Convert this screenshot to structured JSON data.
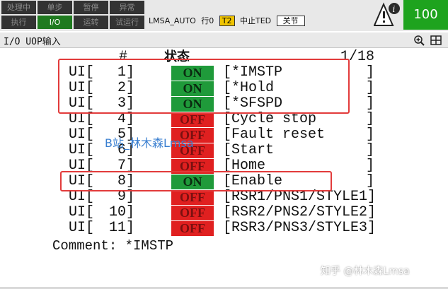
{
  "topbar": {
    "status_buttons": [
      {
        "label": "处理中",
        "state": "dim"
      },
      {
        "label": "单步",
        "state": "dim"
      },
      {
        "label": "暂停",
        "state": "dim"
      },
      {
        "label": "异常",
        "state": "dim"
      },
      {
        "label": "执行",
        "state": "dim"
      },
      {
        "label": "I/O",
        "state": "on"
      },
      {
        "label": "运转",
        "state": "dim"
      },
      {
        "label": "试运行",
        "state": "dim"
      }
    ],
    "program": "LMSA_AUTO",
    "line": "行0",
    "mode": "T2",
    "state": "中止TED",
    "joint": "关节",
    "override": "100"
  },
  "title": {
    "text": "I/O UOP输入"
  },
  "table": {
    "hash_header": "#",
    "status_header": "状态",
    "page": "1/18",
    "rows": [
      {
        "label": "UI[",
        "num": "1]",
        "state": "ON",
        "desc": "[*IMSTP",
        "close": "]"
      },
      {
        "label": "UI[",
        "num": "2]",
        "state": "ON",
        "desc": "[*Hold",
        "close": "]"
      },
      {
        "label": "UI[",
        "num": "3]",
        "state": "ON",
        "desc": "[*SFSPD",
        "close": "]"
      },
      {
        "label": "UI[",
        "num": "4]",
        "state": "OFF",
        "desc": "[Cycle stop",
        "close": "]"
      },
      {
        "label": "UI[",
        "num": "5]",
        "state": "OFF",
        "desc": "[Fault reset",
        "close": "]"
      },
      {
        "label": "UI[",
        "num": "6]",
        "state": "OFF",
        "desc": "[Start",
        "close": "]"
      },
      {
        "label": "UI[",
        "num": "7]",
        "state": "OFF",
        "desc": "[Home",
        "close": "]"
      },
      {
        "label": "UI[",
        "num": "8]",
        "state": "ON",
        "desc": "[Enable",
        "close": "]"
      },
      {
        "label": "UI[",
        "num": "9]",
        "state": "OFF",
        "desc": "[RSR1/PNS1/STYLE1]",
        "close": ""
      },
      {
        "label": "UI[",
        "num": "10]",
        "state": "OFF",
        "desc": "[RSR2/PNS2/STYLE2]",
        "close": ""
      },
      {
        "label": "UI[",
        "num": "11]",
        "state": "OFF",
        "desc": "[RSR3/PNS3/STYLE3]",
        "close": ""
      }
    ]
  },
  "comment": "Comment: *IMSTP",
  "watermarks": {
    "b": "B站_林木森Lmsa",
    "zh": "知乎 @林木森Lmsa"
  },
  "colors": {
    "on": "#1f9a3a",
    "off": "#e02020",
    "highlight": "#e23b3b"
  }
}
